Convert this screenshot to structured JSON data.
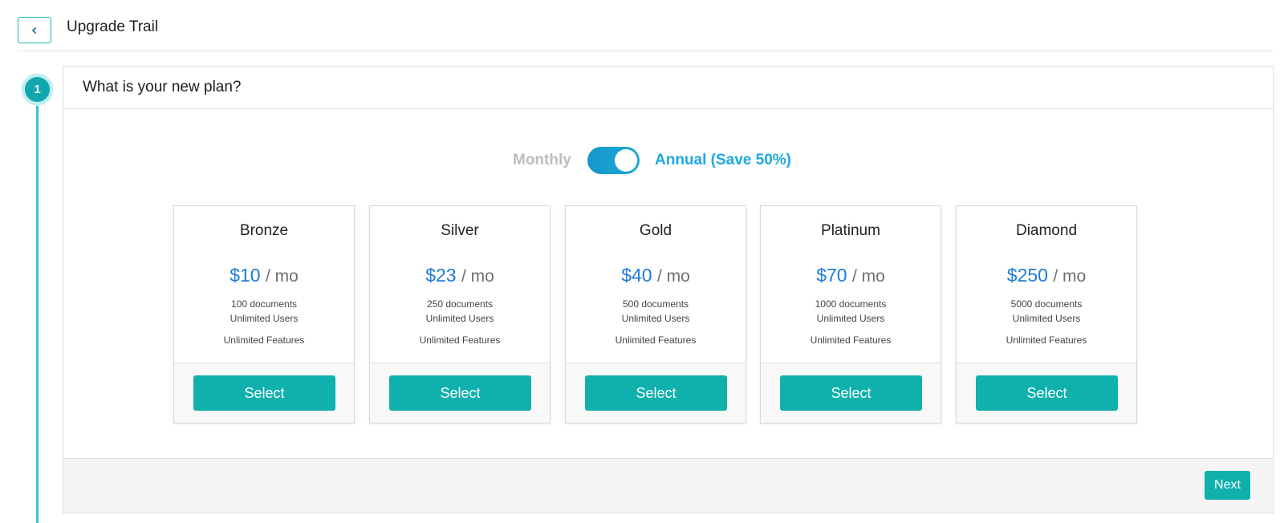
{
  "header": {
    "back_icon": "chevron-left-icon",
    "title": "Upgrade Trail"
  },
  "step": {
    "number": "1",
    "heading": "What is your new plan?"
  },
  "billing": {
    "monthly_label": "Monthly",
    "annual_label": "Annual (Save 50%)",
    "annual_selected": true
  },
  "plans": [
    {
      "name": "Bronze",
      "price": "$10",
      "period": "/ mo",
      "documents": "100 documents",
      "users": "Unlimited Users",
      "features": "Unlimited Features",
      "button": "Select"
    },
    {
      "name": "Silver",
      "price": "$23",
      "period": "/ mo",
      "documents": "250 documents",
      "users": "Unlimited Users",
      "features": "Unlimited Features",
      "button": "Select"
    },
    {
      "name": "Gold",
      "price": "$40",
      "period": "/ mo",
      "documents": "500 documents",
      "users": "Unlimited Users",
      "features": "Unlimited Features",
      "button": "Select"
    },
    {
      "name": "Platinum",
      "price": "$70",
      "period": "/ mo",
      "documents": "1000 documents",
      "users": "Unlimited Users",
      "features": "Unlimited Features",
      "button": "Select"
    },
    {
      "name": "Diamond",
      "price": "$250",
      "period": "/ mo",
      "documents": "5000 documents",
      "users": "Unlimited Users",
      "features": "Unlimited Features",
      "button": "Select"
    }
  ],
  "footer": {
    "next_label": "Next"
  },
  "colors": {
    "accent": "#10b1ad",
    "price": "#1e7bd8",
    "annual": "#1ea8e3",
    "toggle": "#1297c9"
  }
}
